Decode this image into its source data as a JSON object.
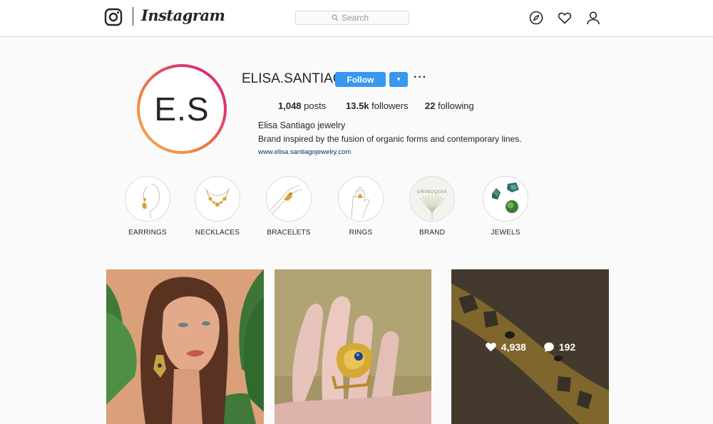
{
  "nav": {
    "wordmark": "Instagram",
    "search_placeholder": "Search",
    "icons": [
      "instagram-logo-icon",
      "search-icon",
      "compass-icon",
      "heart-icon",
      "user-icon"
    ]
  },
  "profile": {
    "avatar_text": "E.S",
    "username": "ELISA.SANTIAGO",
    "follow_label": "Follow",
    "dropdown_label": "▾",
    "more_label": "···",
    "posts_count": "1,048",
    "posts_label": "posts",
    "followers_count": "13.5k",
    "followers_label": "followers",
    "following_count": "22",
    "following_label": "following",
    "full_name": "Elisa Santiago jewelry",
    "bio": "Brand inspired by the fusion of organic forms and contemporary lines.",
    "website": "www.elisa.santiagojewelry.com"
  },
  "highlights": [
    {
      "label": "EARRINGS"
    },
    {
      "label": "NECKLACES"
    },
    {
      "label": "BRACELETS"
    },
    {
      "label": "RINGS"
    },
    {
      "label": "BRAND",
      "image_text": "ORINOQUIA"
    },
    {
      "label": "JEWELS"
    }
  ],
  "posts": [
    {
      "name": "woman-earrings"
    },
    {
      "name": "hand-ring"
    },
    {
      "name": "gold-bracelet",
      "likes": "4,938",
      "comments": "192"
    }
  ],
  "colors": {
    "accent": "#3897f0",
    "link": "#003569",
    "border": "#dbdbdb",
    "background": "#fafafa"
  }
}
